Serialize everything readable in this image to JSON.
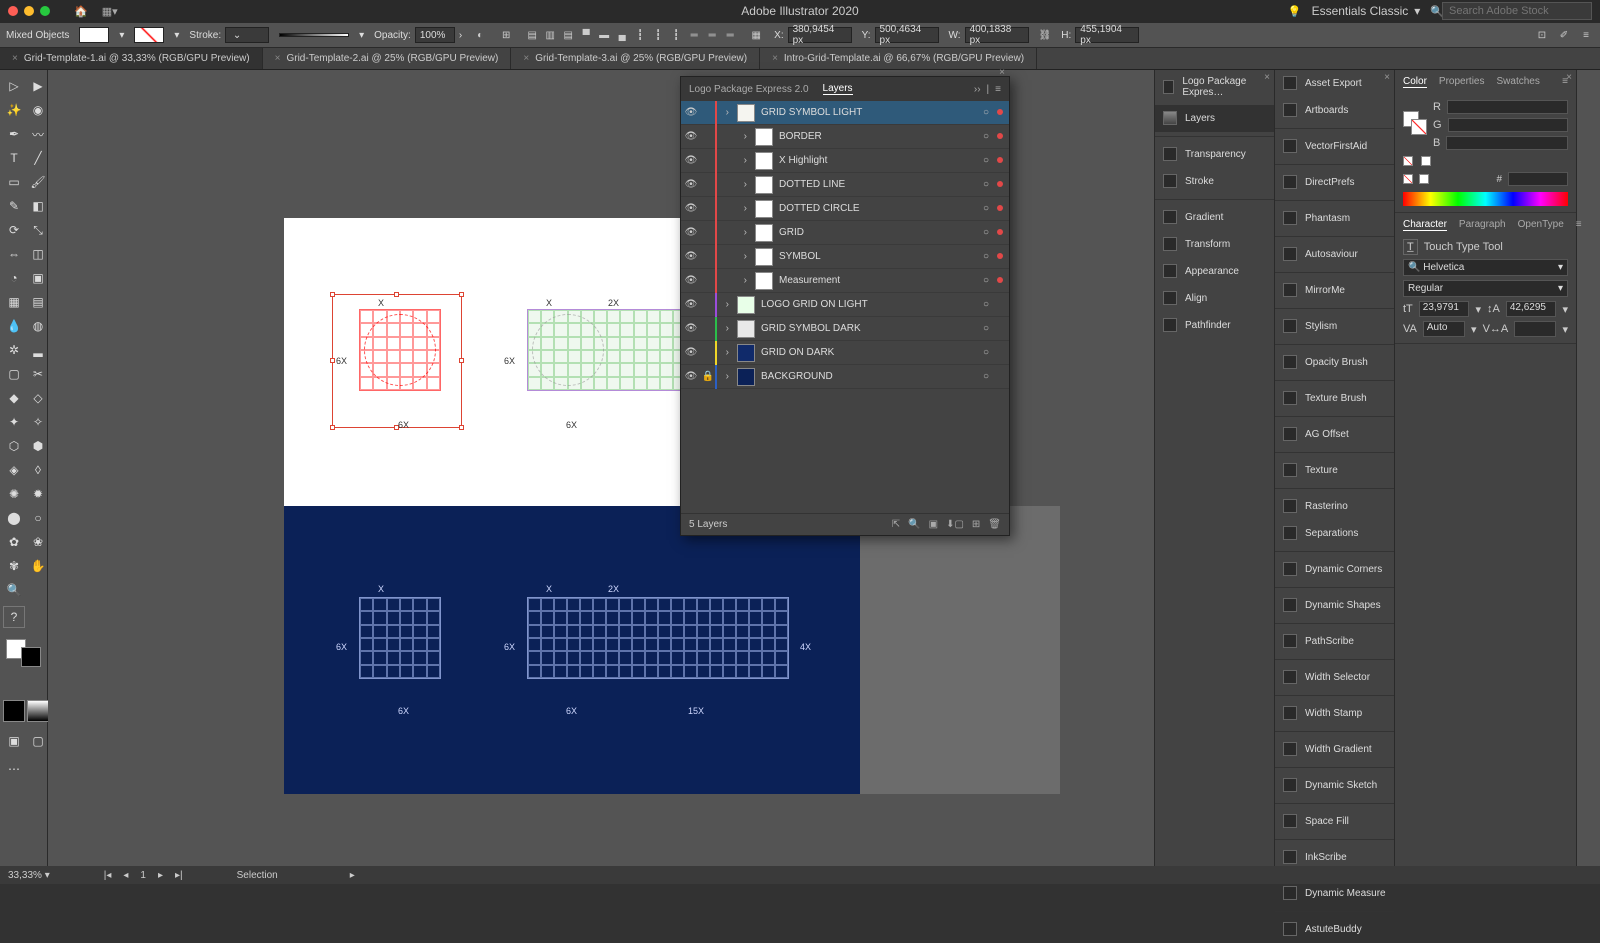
{
  "app": {
    "title": "Adobe Illustrator 2020"
  },
  "workspace": {
    "label": "Essentials Classic"
  },
  "stock_search": {
    "placeholder": "Search Adobe Stock"
  },
  "control": {
    "selection": "Mixed Objects",
    "stroke_label": "Stroke:",
    "opacity_label": "Opacity:",
    "opacity_value": "100%",
    "x_label": "X:",
    "x": "380,9454 px",
    "y_label": "Y:",
    "y": "500,4634 px",
    "w_label": "W:",
    "w": "400,1838 px",
    "h_label": "H:",
    "h": "455,1904 px"
  },
  "tabs": [
    {
      "label": "Grid-Template-1.ai @ 33,33% (RGB/GPU Preview)",
      "active": true
    },
    {
      "label": "Grid-Template-2.ai @ 25% (RGB/GPU Preview)",
      "active": false
    },
    {
      "label": "Grid-Template-3.ai @ 25% (RGB/GPU Preview)",
      "active": false
    },
    {
      "label": "Intro-Grid-Template.ai @ 66,67% (RGB/GPU Preview)",
      "active": false
    }
  ],
  "layers_panel": {
    "tabs": [
      "Logo Package Express 2.0",
      "Layers"
    ],
    "active_tab": 1,
    "footer": "5 Layers",
    "rows": [
      {
        "name": "GRID SYMBOL LIGHT",
        "vis": true,
        "sel": true,
        "color": "#e24848",
        "indent": 0,
        "expand": true,
        "thumb": "#f5f5f0",
        "seldot": "#e24848"
      },
      {
        "name": "BORDER",
        "vis": true,
        "sel": false,
        "color": "#e24848",
        "indent": 1,
        "expand": true,
        "thumb": "#fff",
        "seldot": "#e24848"
      },
      {
        "name": "X Highlight",
        "vis": true,
        "sel": false,
        "color": "#e24848",
        "indent": 1,
        "expand": true,
        "thumb": "#fff",
        "seldot": "#e24848"
      },
      {
        "name": "DOTTED LINE",
        "vis": true,
        "sel": false,
        "color": "#e24848",
        "indent": 1,
        "expand": true,
        "thumb": "#fff",
        "seldot": "#e24848"
      },
      {
        "name": "DOTTED CIRCLE",
        "vis": true,
        "sel": false,
        "color": "#e24848",
        "indent": 1,
        "expand": true,
        "thumb": "#fff",
        "seldot": "#e24848"
      },
      {
        "name": "GRID",
        "vis": true,
        "sel": false,
        "color": "#e24848",
        "indent": 1,
        "expand": true,
        "thumb": "#fff",
        "seldot": "#e24848"
      },
      {
        "name": "SYMBOL",
        "vis": true,
        "sel": false,
        "color": "#e24848",
        "indent": 1,
        "expand": true,
        "thumb": "#fff",
        "seldot": "#e24848"
      },
      {
        "name": "Measurement",
        "vis": true,
        "sel": false,
        "color": "#e24848",
        "indent": 1,
        "expand": true,
        "thumb": "#fff",
        "seldot": "#e24848"
      },
      {
        "name": "LOGO GRID ON LIGHT",
        "vis": true,
        "sel": false,
        "color": "#9b4ddb",
        "indent": 0,
        "expand": false,
        "thumb": "#e8ffe8",
        "seldot": ""
      },
      {
        "name": "GRID SYMBOL DARK",
        "vis": true,
        "sel": false,
        "color": "#2bbf4a",
        "indent": 0,
        "expand": false,
        "thumb": "#e8e8e8",
        "seldot": ""
      },
      {
        "name": "GRID ON DARK",
        "vis": true,
        "sel": false,
        "color": "#f0d628",
        "indent": 0,
        "expand": false,
        "thumb": "#102a6a",
        "seldot": ""
      },
      {
        "name": "BACKGROUND",
        "vis": true,
        "sel": false,
        "color": "#2b5fc4",
        "indent": 0,
        "expand": false,
        "thumb": "#0b2157",
        "seldot": "",
        "lock": true
      }
    ]
  },
  "panels_a": {
    "items": [
      {
        "label": "Logo Package Expres…"
      },
      {
        "label": "Layers",
        "sel": true
      },
      {
        "label": "Transparency"
      },
      {
        "label": "Stroke"
      },
      {
        "label": "Gradient"
      },
      {
        "label": "Transform"
      },
      {
        "label": "Appearance"
      },
      {
        "label": "Align"
      },
      {
        "label": "Pathfinder"
      }
    ]
  },
  "panels_b": {
    "items": [
      {
        "label": "Asset Export"
      },
      {
        "label": "Artboards"
      },
      {
        "label": "VectorFirstAid"
      },
      {
        "label": "DirectPrefs"
      },
      {
        "label": "Phantasm"
      },
      {
        "label": "Autosaviour"
      },
      {
        "label": "MirrorMe"
      },
      {
        "label": "Stylism"
      },
      {
        "label": "Opacity Brush"
      },
      {
        "label": "Texture Brush"
      },
      {
        "label": "AG Offset"
      },
      {
        "label": "Texture"
      },
      {
        "label": "Rasterino"
      },
      {
        "label": "Separations"
      },
      {
        "label": "Dynamic Corners"
      },
      {
        "label": "Dynamic Shapes"
      },
      {
        "label": "PathScribe"
      },
      {
        "label": "Width Selector"
      },
      {
        "label": "Width Stamp"
      },
      {
        "label": "Width Gradient"
      },
      {
        "label": "Dynamic Sketch"
      },
      {
        "label": "Space Fill"
      },
      {
        "label": "InkScribe"
      },
      {
        "label": "Dynamic Measure"
      },
      {
        "label": "AstuteBuddy"
      }
    ]
  },
  "color_panel": {
    "tabs": [
      "Color",
      "Properties",
      "Swatches"
    ],
    "hash": "#",
    "rgb": {
      "r": "R",
      "g": "G",
      "b": "B"
    },
    "fill_sw": "#ffffff",
    "stroke_sw": "#ffffff"
  },
  "char_panel": {
    "tabs": [
      "Character",
      "Paragraph",
      "OpenType"
    ],
    "touch": "Touch Type Tool",
    "font": "Helvetica",
    "style": "Regular",
    "size": "23,9791",
    "leading": "42,6295",
    "kerning": "Auto"
  },
  "status": {
    "zoom": "33,33%",
    "artboard": "1",
    "mode": "Selection"
  },
  "canvas_labels": {
    "x": "X",
    "2x": "2X",
    "6x": "6X",
    "4x": "4X",
    "15x": "15X"
  }
}
